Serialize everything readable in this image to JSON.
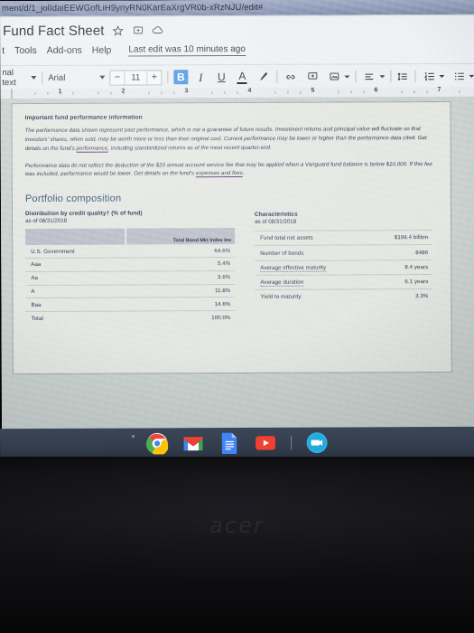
{
  "browser": {
    "url": "ment/d/1_jolIdaiEEWGofLiH9ynyRN0KarEaXrgVR0b-xRzNJU/edit#"
  },
  "docs": {
    "title": "Fund Fact Sheet",
    "star_icon": "star-icon",
    "move_icon": "move-to-folder-icon",
    "cloud_icon": "cloud-status-icon",
    "menu": [
      {
        "label": "t"
      },
      {
        "label": "Tools"
      },
      {
        "label": "Add-ons"
      },
      {
        "label": "Help"
      }
    ],
    "last_edit": "Last edit was 10 minutes ago"
  },
  "toolbar": {
    "paragraph_style": "nal text",
    "font_name": "Arial",
    "font_size": "11",
    "decrease_label": "−",
    "increase_label": "+",
    "bold_label": "B",
    "italic_label": "I",
    "underline_label": "U",
    "text_color_label": "A",
    "highlight_icon": "highlight-pen-icon",
    "link_icon": "insert-link-icon",
    "comment_icon": "add-comment-icon",
    "image_icon": "insert-image-icon",
    "align_icon": "text-align-icon",
    "line_spacing_icon": "line-spacing-icon",
    "numbered_list_icon": "numbered-list-icon",
    "bulleted_list_icon": "bulleted-list-icon"
  },
  "ruler": {
    "numbers": [
      "1",
      "2",
      "3",
      "4",
      "5",
      "6",
      "7"
    ]
  },
  "document": {
    "disclaimer_heading": "Important fund performance information",
    "disclaimer_p1_a": "The performance data shown represent past performance, which is not a guarantee of future results. Investment returns and principal value will fluctuate so that investors' shares, when sold, may be worth more or less than their original cost. Current performance may be lower or higher than the performance data cited. Get details on the fund's ",
    "disclaimer_p1_link": "performance",
    "disclaimer_p1_b": ", including standardized returns as of the most recent quarter-end.",
    "disclaimer_p2_a": "Performance data do not reflect the deduction of the $20 annual account service fee that may be applied when a Vanguard fund balance is below $10,000. If this fee was included, performance would be lower. Get details on the fund's ",
    "disclaimer_p2_link": "expenses and fees",
    "disclaimer_p2_b": ".",
    "section_title": "Portfolio composition",
    "credit_quality": {
      "subtitle": "Distribution by credit quality† (% of fund)",
      "as_of": "as of 08/31/2018",
      "column_header": "Total Bond Mkt Index Inv",
      "rows": [
        {
          "label": "U.S. Government",
          "value": "64.6%"
        },
        {
          "label": "Aaa",
          "value": "5.4%"
        },
        {
          "label": "Aa",
          "value": "3.6%"
        },
        {
          "label": "A",
          "value": "11.8%"
        },
        {
          "label": "Baa",
          "value": "14.6%"
        },
        {
          "label": "Total",
          "value": "100.0%"
        }
      ]
    },
    "characteristics": {
      "subtitle": "Characteristics",
      "as_of": "as of 08/31/2018",
      "rows": [
        {
          "label": "Fund total net assets",
          "value": "$199.4 billion"
        },
        {
          "label": "Number of bonds",
          "value": "8486"
        },
        {
          "label": "Average effective maturity",
          "value": "8.4 years"
        },
        {
          "label": "Average duration",
          "value": "6.1 years"
        },
        {
          "label": "Yield to maturity",
          "value": "3.3%"
        }
      ]
    }
  },
  "shelf": {
    "items": [
      {
        "name": "chrome-icon",
        "label": "Chrome"
      },
      {
        "name": "gmail-icon",
        "label": "Gmail"
      },
      {
        "name": "google-docs-icon",
        "label": "Docs"
      },
      {
        "name": "youtube-icon",
        "label": "YouTube"
      },
      {
        "name": "camera-app-icon",
        "label": "Camera"
      }
    ]
  },
  "device": {
    "brand": "acer"
  },
  "colors": {
    "accent_blue": "#4a90e2",
    "docs_blue": "#31537a",
    "shelf": "#333d4d",
    "page": "#e3e6e1"
  }
}
